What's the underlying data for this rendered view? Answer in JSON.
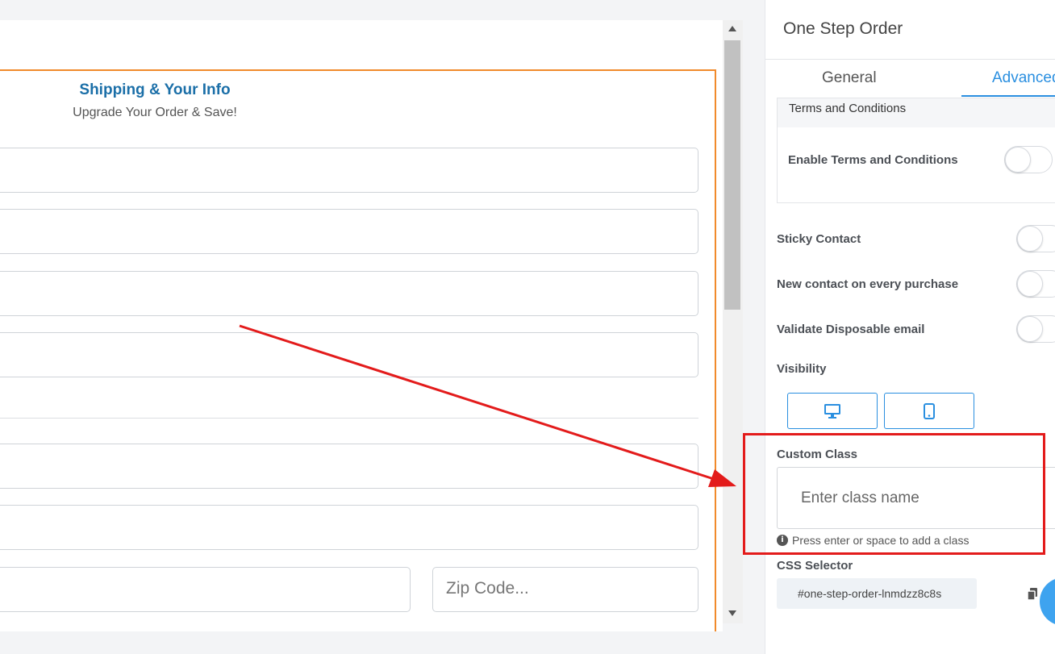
{
  "form": {
    "title": "Shipping & Your Info",
    "subtitle": "Upgrade Your Order & Save!",
    "zip_placeholder": "Zip Code..."
  },
  "panel": {
    "title": "One Step Order",
    "tabs": [
      {
        "label": "General",
        "active": false
      },
      {
        "label": "Advanced",
        "active": true
      }
    ],
    "terms_section_label": "Terms and Conditions",
    "settings": [
      {
        "label": "Enable Terms and Conditions",
        "enabled": false
      },
      {
        "label": "Sticky Contact",
        "enabled": false
      },
      {
        "label": "New contact on every purchase",
        "enabled": false
      },
      {
        "label": "Validate Disposable email",
        "enabled": false
      }
    ],
    "visibility_label": "Visibility",
    "visibility_options": [
      "desktop-icon",
      "mobile-icon"
    ],
    "custom_class_label": "Custom Class",
    "custom_class_placeholder": "Enter class name",
    "custom_class_hint": "Press enter or space to add a class",
    "css_selector_label": "CSS Selector",
    "css_selector_value": "#one-step-order-lnmdzz8c8s"
  },
  "colors": {
    "accent": "#2a8fe0",
    "form_title": "#1b6fa8",
    "form_border": "#f18a2b",
    "annotation": "#e31b1b"
  }
}
